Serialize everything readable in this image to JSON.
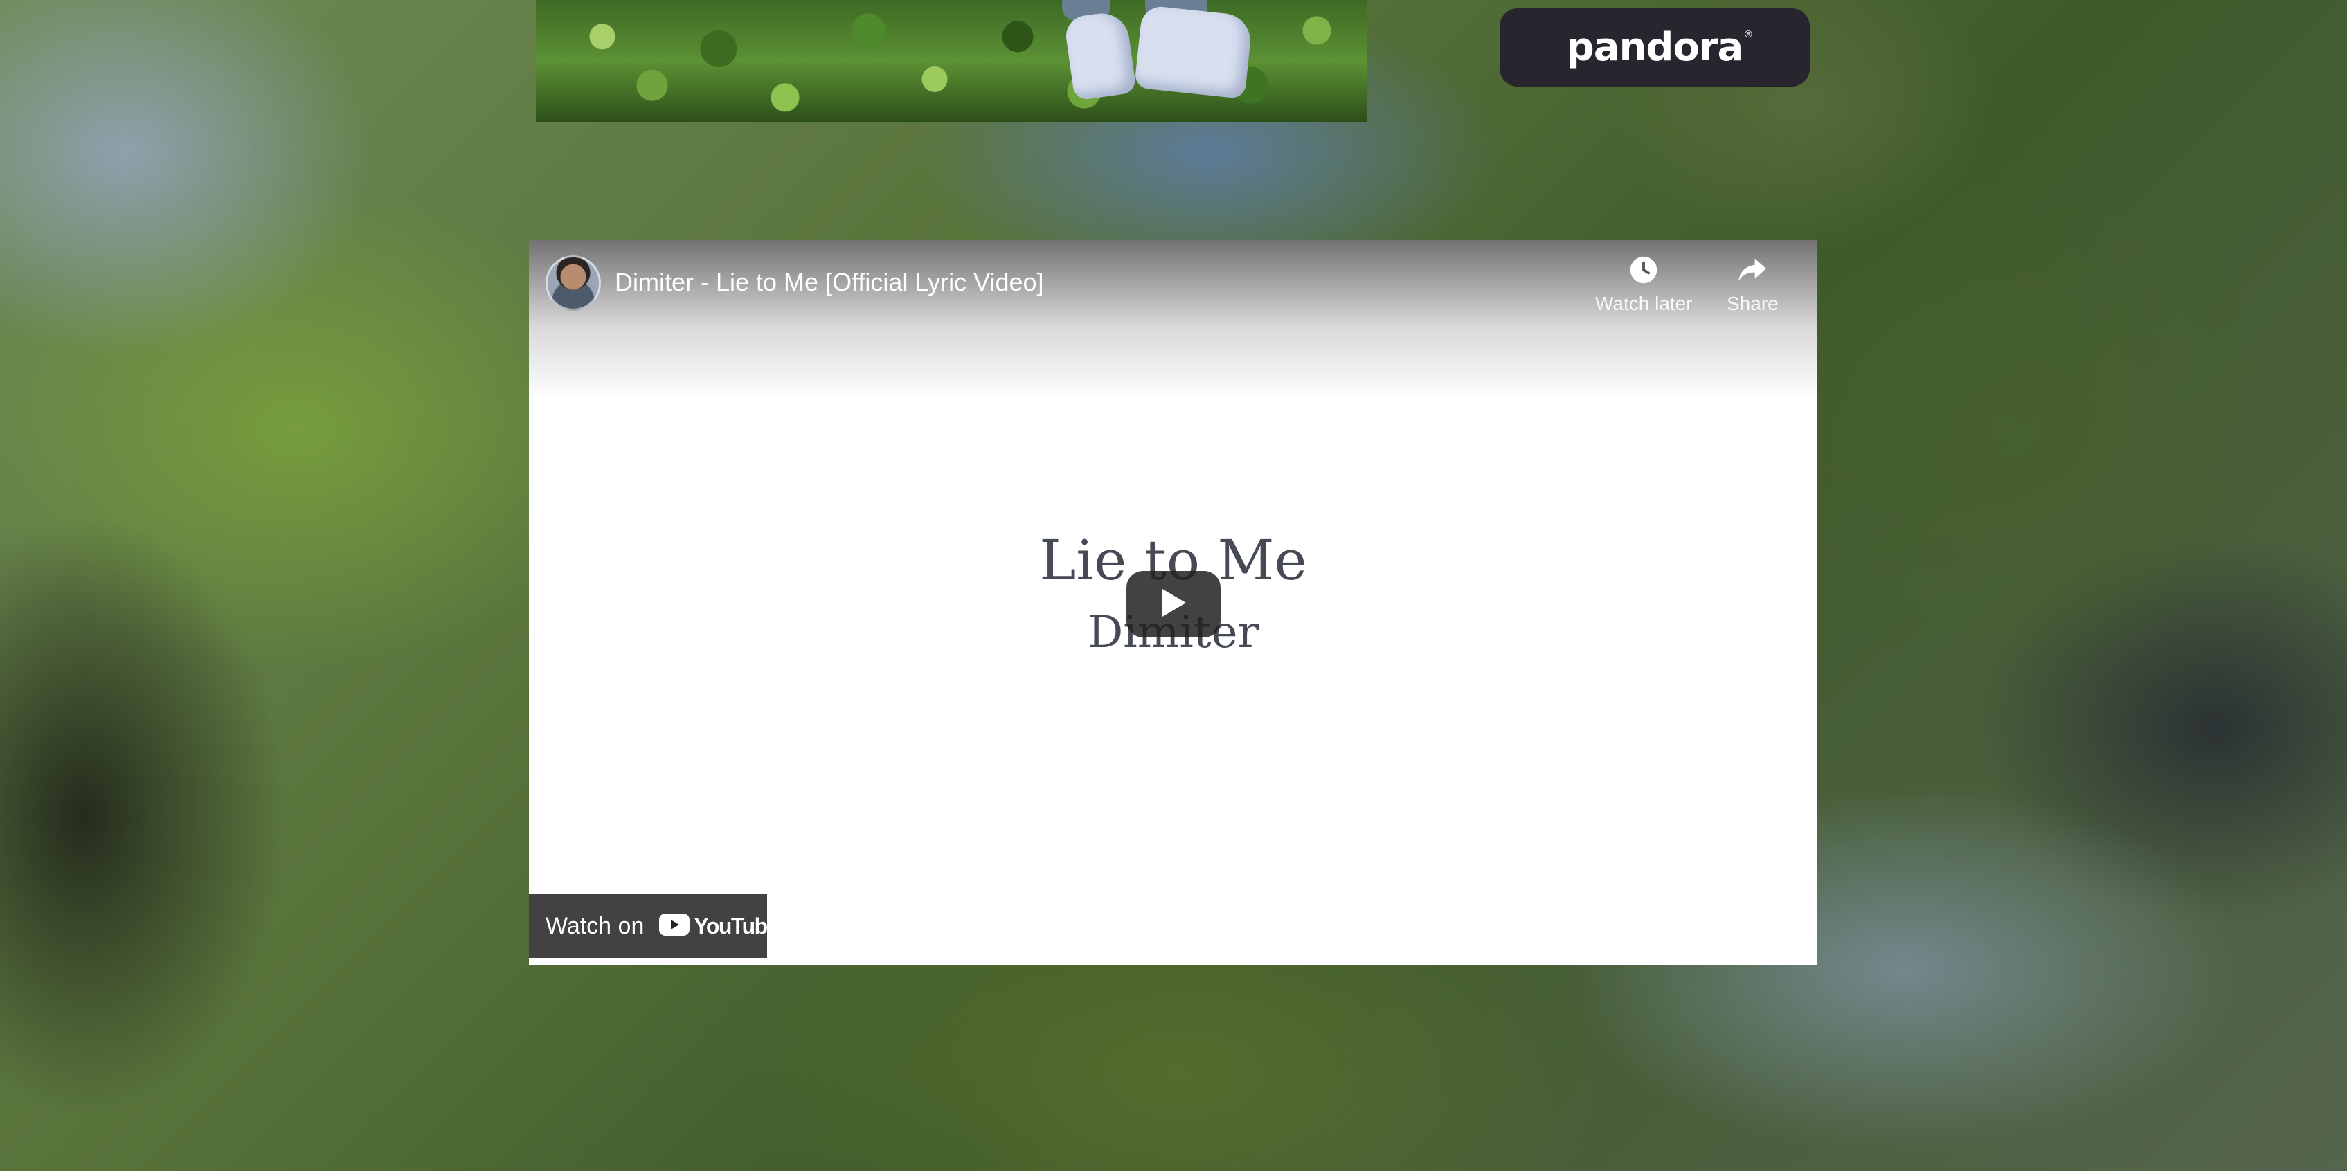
{
  "pandora": {
    "logo_text": "pandora",
    "reg_mark": "®"
  },
  "video": {
    "title": "Dimiter - Lie to Me [Official Lyric Video]",
    "watch_later_label": "Watch later",
    "share_label": "Share",
    "thumbnail_title": "Lie to Me",
    "thumbnail_artist": "Dimiter",
    "watch_on_label": "Watch on",
    "youtube_logo_text": "YouTube"
  },
  "icons": {
    "watch_later": "clock-icon",
    "share": "share-arrow-icon",
    "play": "play-icon",
    "youtube": "youtube-logo-icon"
  },
  "colors": {
    "pandora_button_bg": "#28252f",
    "video_overlay": "#212121",
    "thumbnail_text": "#454a55",
    "youtube_red": "#ff0000"
  }
}
